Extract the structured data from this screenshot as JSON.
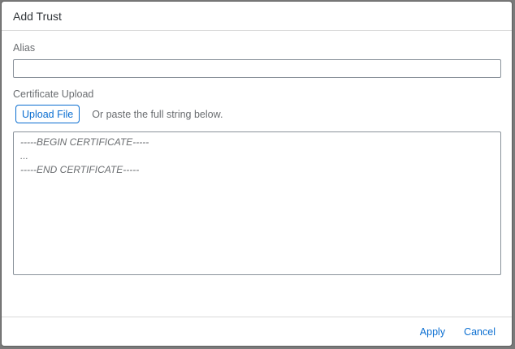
{
  "dialog": {
    "title": "Add Trust"
  },
  "alias": {
    "label": "Alias",
    "value": "",
    "placeholder": ""
  },
  "certificate": {
    "label": "Certificate Upload",
    "upload_button": "Upload File",
    "paste_hint": "Or paste the full string below.",
    "placeholder_lines": [
      "-----BEGIN CERTIFICATE-----",
      "...",
      "-----END CERTIFICATE-----"
    ]
  },
  "footer": {
    "apply_label": "Apply",
    "cancel_label": "Cancel"
  },
  "colors": {
    "accent": "#0a6ed1",
    "label_text": "#6a6d70",
    "title_text": "#32363a",
    "backdrop": "#7a7a7a"
  }
}
